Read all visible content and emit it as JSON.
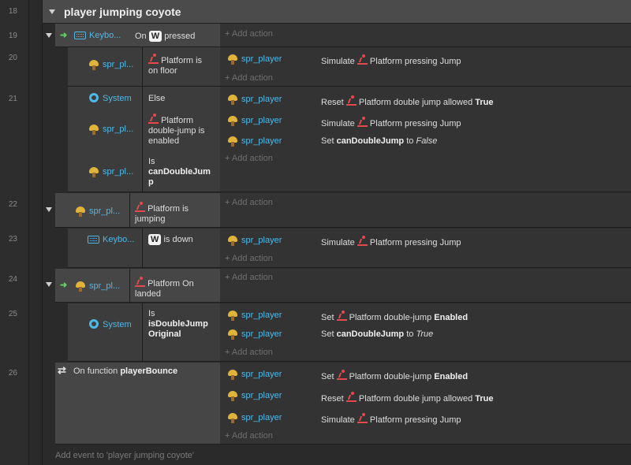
{
  "group": {
    "title": "player jumping coyote",
    "add_event": "Add event to 'player jumping coyote'"
  },
  "common": {
    "add_action": "Add action",
    "keyboard_short": "Keybo...",
    "spr_short": "spr_pl...",
    "spr_player": "spr_player",
    "system": "System",
    "platform": "Platform",
    "simulate": "Simulate",
    "reset": "Reset",
    "set": "Set",
    "pressing_jump": "pressing Jump",
    "double_jump_allowed": "double jump allowed",
    "true_bold": "True",
    "true_italic": "True",
    "false_italic": "False",
    "double_jump": "double-jump",
    "enabled": "Enabled",
    "can_double_jump": "canDoubleJump",
    "to": "to",
    "w": "W"
  },
  "rows": {
    "r18": "18",
    "r19": "19",
    "r20": "20",
    "r21": "21",
    "r22": "22",
    "r23": "23",
    "r24": "24",
    "r25": "25",
    "r26": "26"
  },
  "conditions": {
    "on": "On",
    "pressed": "pressed",
    "is_on_floor_1": "Platform is",
    "is_on_floor_2": "on floor",
    "else": "Else",
    "dj_enabled_1": "Platform",
    "dj_enabled_2": "double-jump is",
    "dj_enabled_3": "enabled",
    "is": "Is",
    "can_double_jum": "canDoubleJum",
    "p": "p",
    "jumping_1": "Platform is",
    "jumping_2": "jumping",
    "is_down": "is down",
    "on_landed_1": "Platform On",
    "on_landed_2": "landed",
    "is_double_jump": "isDoubleJump",
    "original": "Original",
    "on_function": "On function",
    "player_bounce": "playerBounce"
  }
}
